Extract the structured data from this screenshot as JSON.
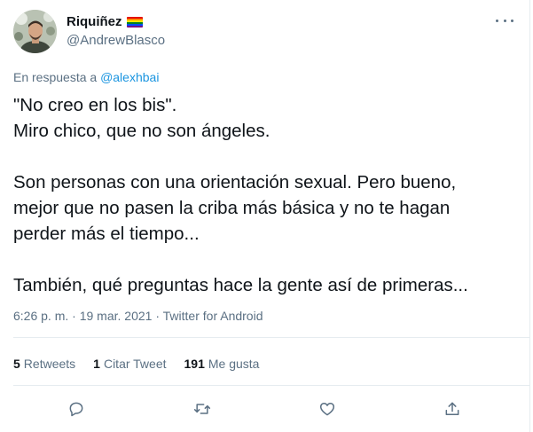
{
  "user": {
    "display_name": "Riquiñez",
    "handle": "@AndrewBlasco"
  },
  "reply": {
    "prefix": "En respuesta a",
    "mention": "@alexhbai"
  },
  "body": {
    "line1": "\"No creo en los bis\".",
    "line2": "Miro chico, que no son ángeles.",
    "line3": "Son personas con una orientación sexual. Pero bueno,",
    "line4": "mejor que no pasen la criba más básica y no te hagan",
    "line5": "perder más el tiempo...",
    "line6": "También, qué preguntas hace la gente así de primeras..."
  },
  "meta": {
    "time": "6:26 p. m.",
    "separator1": "·",
    "date": "19 mar. 2021",
    "separator2": "·",
    "source": "Twitter for Android"
  },
  "stats": {
    "retweets_count": "5",
    "retweets_label": "Retweets",
    "quotes_count": "1",
    "quotes_label": "Citar Tweet",
    "likes_count": "191",
    "likes_label": "Me gusta"
  },
  "icons": {
    "reply": "reply-icon",
    "retweet": "retweet-icon",
    "like": "heart-icon",
    "share": "share-icon",
    "more": "more-icon",
    "flag": "rainbow-flag-icon"
  },
  "colors": {
    "text": "#0f1419",
    "secondary": "#5b7083",
    "link": "#1b95e0",
    "divider": "#e6ecf0"
  }
}
